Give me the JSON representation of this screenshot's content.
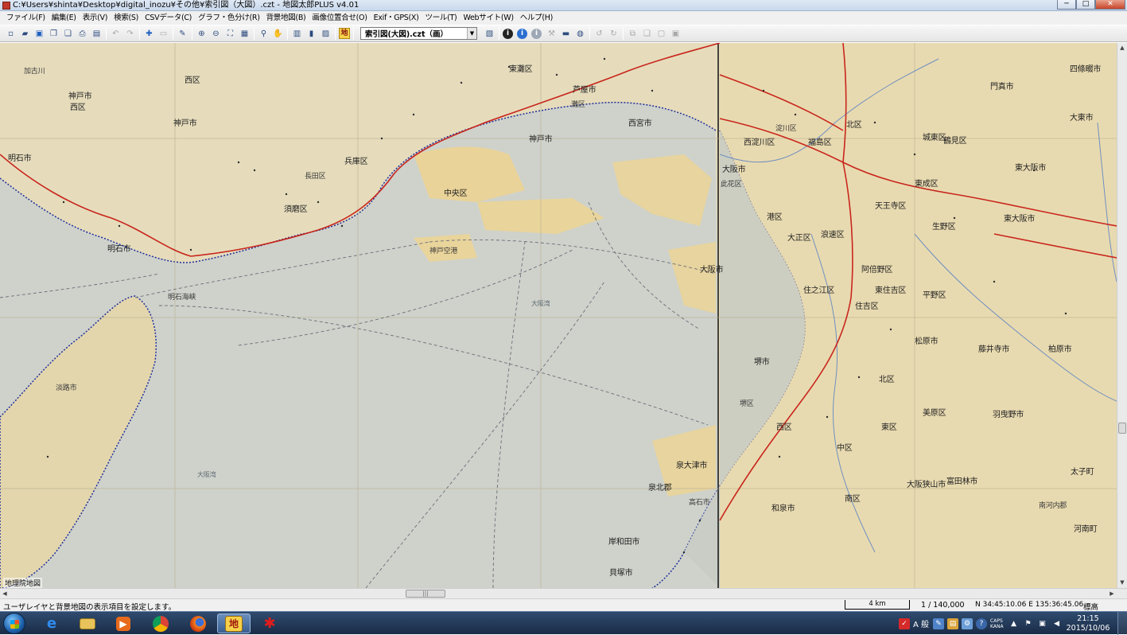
{
  "window": {
    "title": "C:¥Users¥shinta¥Desktop¥digital_inozu¥その他¥索引図（大図）.czt - 地図太郎PLUS v4.01",
    "buttons": {
      "minimize": "─",
      "maximize": "□",
      "close": "✕"
    }
  },
  "menu": {
    "items": [
      "ファイル(F)",
      "編集(E)",
      "表示(V)",
      "検索(S)",
      "CSVデータ(C)",
      "グラフ・色分け(R)",
      "背景地図(B)",
      "画像位置合せ(O)",
      "Exif・GPS(X)",
      "ツール(T)",
      "Webサイト(W)",
      "ヘルプ(H)"
    ]
  },
  "toolbar": {
    "map_select": "索引図(大図).czt（画）",
    "icons": [
      "new-icon",
      "open-icon",
      "save-icon",
      "copy-icon",
      "paste-icon",
      "print-icon",
      "preview-icon",
      "undo-icon",
      "redo-icon",
      "add-point-icon",
      "layer-icon",
      "edit-icon",
      "zoom-in-icon",
      "zoom-out-icon",
      "fit-icon",
      "full-extent-icon",
      "search-icon",
      "pan-icon",
      "table-icon",
      "chart-icon",
      "image-icon",
      "chizu-icon"
    ]
  },
  "map": {
    "credit": "地理院地図",
    "labels": [
      "加古川",
      "神戸市",
      "西区",
      "西区",
      "神戸市",
      "明石市",
      "須磨区",
      "兵庫区",
      "長田区",
      "中央区",
      "神戸市",
      "灘区",
      "東灘区",
      "芦屋市",
      "西宮市",
      "明石市",
      "明石海峡",
      "大阪湾",
      "大阪湾",
      "神戸空港",
      "大阪市",
      "西淀川区",
      "福島区",
      "北区",
      "城東区",
      "鶴見区",
      "門真市",
      "四條畷市",
      "大東市",
      "東大阪市",
      "東成区",
      "天王寺区",
      "生野区",
      "東大阪市",
      "此花区",
      "港区",
      "大正区",
      "浪速区",
      "阿倍野区",
      "東住吉区",
      "平野区",
      "住之江区",
      "住吉区",
      "松原市",
      "藤井寺市",
      "柏原市",
      "堺市",
      "北区",
      "美原区",
      "羽曳野市",
      "西区",
      "中区",
      "東区",
      "太子町",
      "和泉市",
      "南区",
      "大阪狭山市",
      "富田林市",
      "河南町",
      "南河内郡",
      "泉大津市",
      "泉北郡",
      "岸和田市",
      "貝塚市",
      "高石市",
      "大阪市",
      "淡路市",
      "堺区",
      "淀川区"
    ]
  },
  "statusbar": {
    "message": "ユーザレイヤと背景地図の表示項目を設定します。",
    "scale_distance": "4 km",
    "scale_ratio": "1 / 140,000",
    "coords": "N 34:45:10.06  E 135:36:45.06",
    "elevation_label": "標高"
  },
  "taskbar": {
    "apps": [
      "ie-icon",
      "explorer-icon",
      "media-player-icon",
      "chrome-icon",
      "firefox-icon",
      "chizutaro-icon",
      "paint-icon"
    ],
    "chizutaro_label": "地",
    "tray": {
      "ime_mode": "A 般",
      "caps": "CAPS",
      "kana": "KANA"
    },
    "clock": {
      "time": "21:15",
      "date": "2015/10/06"
    }
  }
}
